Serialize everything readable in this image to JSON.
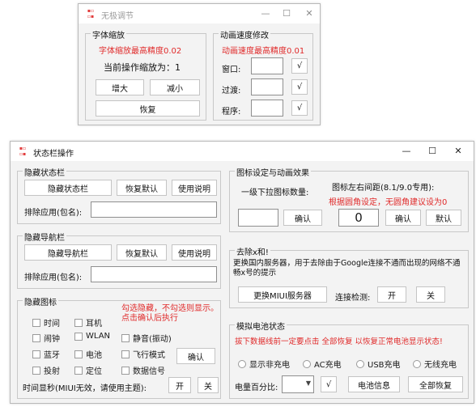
{
  "window1": {
    "title": "无极调节",
    "controls": {
      "minimize": "—",
      "maximize": "☐",
      "close": "✕"
    },
    "font_scale": {
      "group_label": "字体缩放",
      "precision_note": "字体缩放最高精度0.02",
      "current_scale": "当前操作缩放为：1",
      "increase": "增大",
      "decrease": "减小",
      "restore": "恢复"
    },
    "anim_speed": {
      "group_label": "动画速度修改",
      "precision_note": "动画速度最高精度0.01",
      "window_label": "窗口:",
      "transition_label": "过渡:",
      "program_label": "程序:",
      "confirm": "√"
    }
  },
  "window2": {
    "title": "状态栏操作",
    "controls": {
      "minimize": "—",
      "maximize": "☐",
      "close": "✕"
    },
    "hide_statusbar": {
      "group_label": "隐藏状态栏",
      "hide_btn": "隐藏状态栏",
      "restore_btn": "恢复默认",
      "help_btn": "使用说明",
      "exclude_label": "排除应用(包名):"
    },
    "hide_navbar": {
      "group_label": "隐藏导航栏",
      "hide_btn": "隐藏导航栏",
      "restore_btn": "恢复默认",
      "help_btn": "使用说明",
      "exclude_label": "排除应用(包名):"
    },
    "hide_icons": {
      "group_label": "隐藏图标",
      "note": "勾选隐藏，不勾选则显示。点击确认后执行",
      "checkboxes": [
        "时间",
        "耳机",
        "静音(振动)",
        "闹钟",
        "WLAN",
        "蓝牙",
        "电池",
        "飞行模式",
        "投射",
        "定位",
        "数据信号"
      ],
      "confirm_btn": "确认",
      "seconds_label": "时间显秒(MIUI无效，请使用主题):",
      "on_btn": "开",
      "off_btn": "关"
    },
    "icon_anim": {
      "group_label": "图标设定与动画效果",
      "dropdown_label": "一级下拉图标数量:",
      "confirm_btn": "确认",
      "spacing_label": "图标左右间距(8.1/9.0专用):",
      "spacing_note": "根据圆角设定，无圆角建议设为0",
      "spacing_value": "0",
      "spacing_confirm_btn": "确认",
      "spacing_default_btn": "默认"
    },
    "remove_x": {
      "group_label": "去除x和!",
      "description": "更换国内服务器，用于去除由于Google连接不通而出现的网络不通畅x号的提示",
      "replace_btn": "更换MIUI服务器",
      "detect_label": "连接检测:",
      "on_btn": "开",
      "off_btn": "关"
    },
    "battery": {
      "group_label": "模拟电池状态",
      "note": "拔下数据线前一定要点击 全部恢复 以恢复正常电池显示状态!",
      "radios": [
        "显示非充电",
        "AC充电",
        "USB充电",
        "无线充电"
      ],
      "percent_label": "电量百分比:",
      "confirm": "√",
      "info_btn": "电池信息",
      "restore_all_btn": "全部恢复"
    }
  },
  "colors": {
    "accent_red": "#e02a2a",
    "window_bg": "#f3f3f3",
    "titlebar_bg": "#ffffff"
  },
  "icons": {
    "app_icon": "app-logo-icon",
    "dropdown": "chevron-down-icon"
  }
}
